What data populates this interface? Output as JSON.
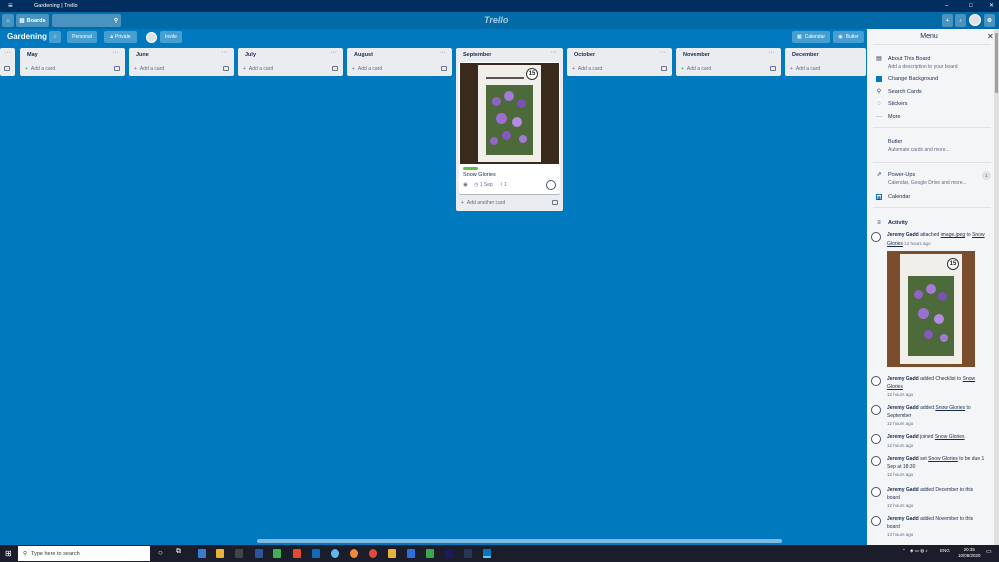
{
  "window": {
    "title": "Gardening | Trello"
  },
  "topbar": {
    "boards_label": "Boards",
    "logo": "Trello"
  },
  "board": {
    "name": "Gardening",
    "team": "Personal",
    "visibility": "Private",
    "invite": "Invite",
    "calendar": "Calendar",
    "butler": "Butler"
  },
  "lists": [
    {
      "title": "May",
      "add": "Add a card"
    },
    {
      "title": "June",
      "add": "Add a card"
    },
    {
      "title": "July",
      "add": "Add a card"
    },
    {
      "title": "August",
      "add": "Add a card"
    },
    {
      "title": "September",
      "add": "Add another card"
    },
    {
      "title": "October",
      "add": "Add a card"
    },
    {
      "title": "November",
      "add": "Add a card"
    },
    {
      "title": "December",
      "add": "Add a card"
    }
  ],
  "card": {
    "title": "Snow Glories",
    "due": "1 Sep",
    "attachments": "1",
    "label_color": "#61bd4f"
  },
  "menu": {
    "title": "Menu",
    "about": "About This Board",
    "about_sub": "Add a description to your board",
    "change_bg": "Change Background",
    "search": "Search Cards",
    "stickers": "Stickers",
    "more": "More",
    "butler": "Butler",
    "butler_sub": "Automate cards and more...",
    "powerups": "Power-Ups",
    "powerups_sub": "Calendar, Google Drive and more...",
    "powerups_count": "1",
    "calendar": "Calendar",
    "activity": "Activity"
  },
  "activity": [
    {
      "user": "Jeremy Gadd",
      "text": " attached ",
      "link": "image.jpeg",
      "text2": " to ",
      "link2": "Snow Glories",
      "time": "12 hours ago"
    },
    {
      "user": "Jeremy Gadd",
      "text": " added Checklist to ",
      "link": "Snow Glories",
      "text2": "",
      "link2": "",
      "time": "12 hours ago"
    },
    {
      "user": "Jeremy Gadd",
      "text": " added ",
      "link": "Snow Glories",
      "text2": " to September",
      "link2": "",
      "time": "12 hours ago"
    },
    {
      "user": "Jeremy Gadd",
      "text": " joined ",
      "link": "Snow Glories",
      "text2": "",
      "link2": "",
      "time": "12 hours ago"
    },
    {
      "user": "Jeremy Gadd",
      "text": " set ",
      "link": "Snow Glories",
      "text2": " to be due 1 Sep at 18:30",
      "link2": "",
      "time": "12 hours ago"
    },
    {
      "user": "Jeremy Gadd",
      "text": " added December to this board",
      "link": "",
      "text2": "",
      "link2": "",
      "time": "12 hours ago"
    },
    {
      "user": "Jeremy Gadd",
      "text": " added November to this board",
      "link": "",
      "text2": "",
      "link2": "",
      "time": "13 hours ago"
    }
  ],
  "taskbar": {
    "search_placeholder": "Type here to search",
    "lang": "ENG",
    "time": "20:35",
    "date": "10/08/2020",
    "packet_number": "15"
  }
}
